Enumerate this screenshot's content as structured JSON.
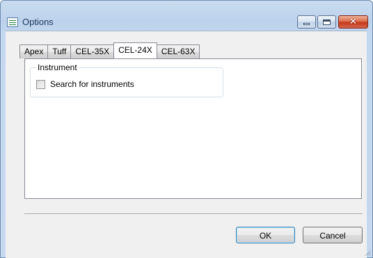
{
  "window": {
    "title": "Options",
    "close_glyph": "✕"
  },
  "tabs": [
    {
      "label": "Apex",
      "selected": false
    },
    {
      "label": "Tuff",
      "selected": false
    },
    {
      "label": "CEL-35X",
      "selected": false
    },
    {
      "label": "CEL-24X",
      "selected": true
    },
    {
      "label": "CEL-63X",
      "selected": false
    }
  ],
  "panel": {
    "group_label": "Instrument",
    "checkbox_label": "Search for instruments",
    "checkbox_checked": false
  },
  "buttons": {
    "ok": "OK",
    "cancel": "Cancel"
  },
  "icons": {
    "app": "options-app-icon",
    "minimize": "minimize-icon",
    "maximize": "maximize-icon",
    "close": "close-icon"
  },
  "colors": {
    "title_text": "#1e395b",
    "close_button": "#c4391b",
    "panel_bg": "#ffffff",
    "dialog_bg": "#f0f0f0"
  }
}
